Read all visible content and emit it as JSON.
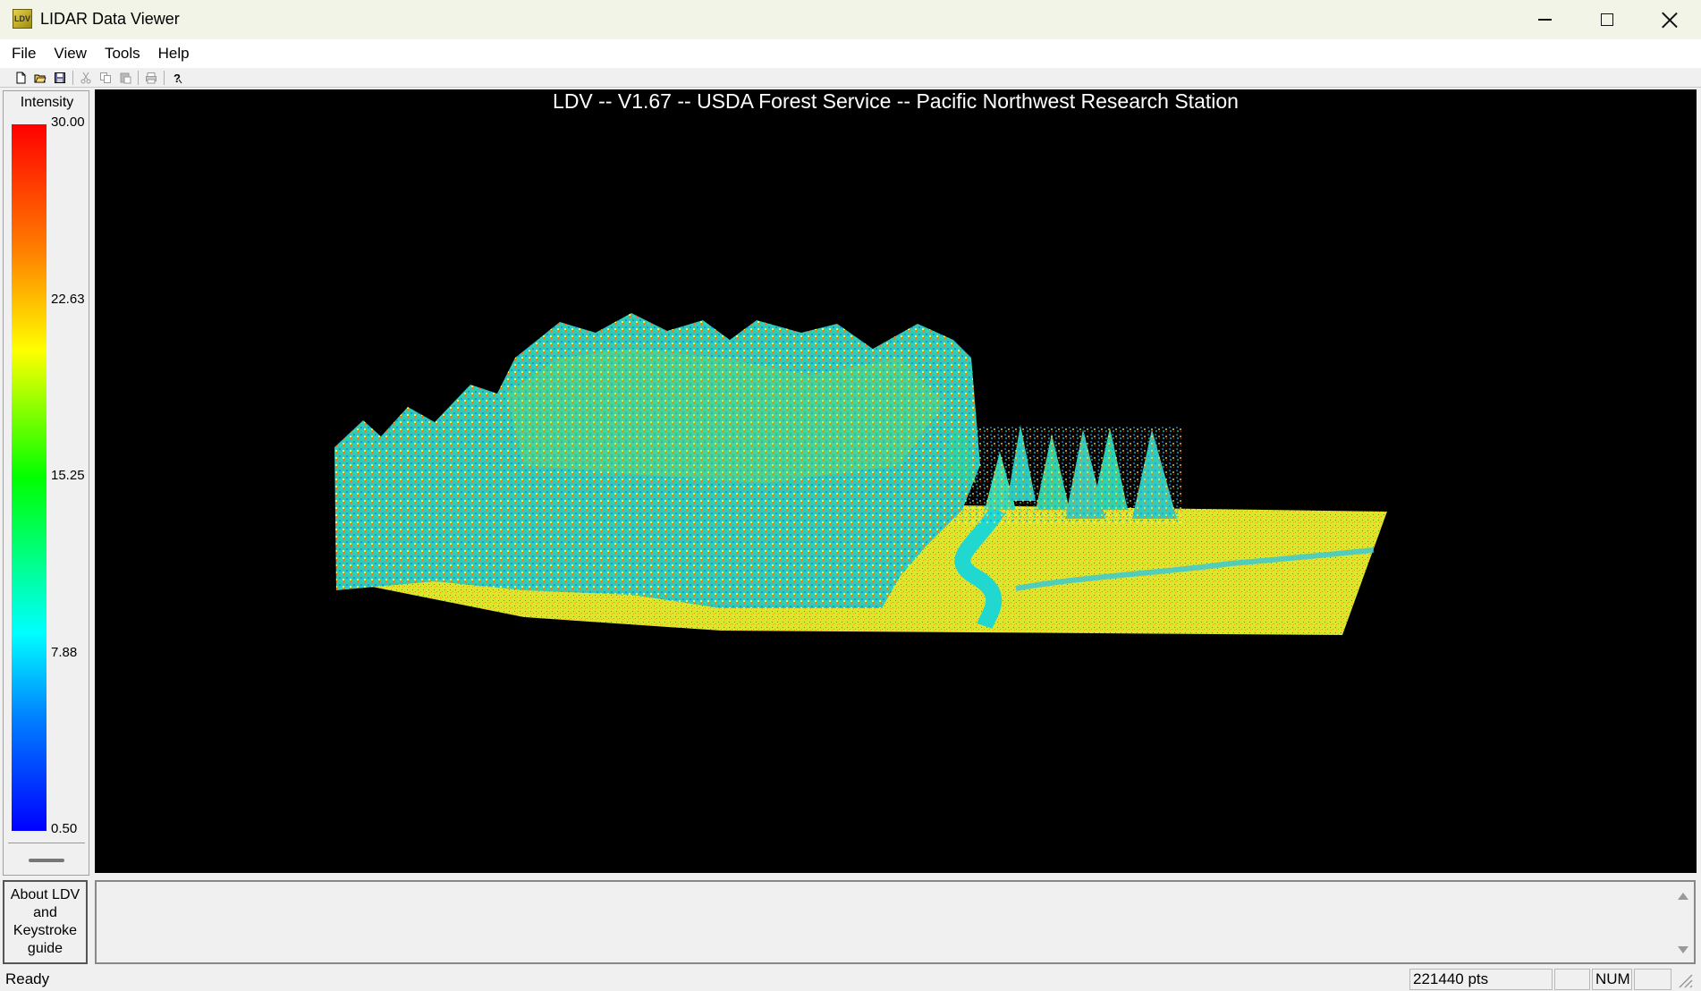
{
  "window": {
    "title": "LIDAR Data Viewer",
    "app_icon_text": "LDV"
  },
  "menu": {
    "items": [
      "File",
      "View",
      "Tools",
      "Help"
    ]
  },
  "toolbar": {
    "icons": [
      "new-file-icon",
      "open-folder-icon",
      "save-icon",
      "cut-icon",
      "copy-icon",
      "paste-icon",
      "print-icon",
      "help-icon"
    ]
  },
  "legend": {
    "title": "Intensity",
    "ticks": [
      "30.00",
      "22.63",
      "15.25",
      "7.88",
      "0.50"
    ],
    "colors": [
      "#ff0000",
      "#ff8000",
      "#ffff00",
      "#00ff00",
      "#00ffff",
      "#0080ff",
      "#0000ff"
    ]
  },
  "viewer": {
    "title": "LDV -- V1.67 -- USDA Forest Service -- Pacific Northwest Research Station",
    "background": "#000000"
  },
  "about_button": {
    "label": "About LDV and Keystroke guide"
  },
  "status": {
    "text": "Ready",
    "points": "221440 pts",
    "num": "NUM"
  }
}
